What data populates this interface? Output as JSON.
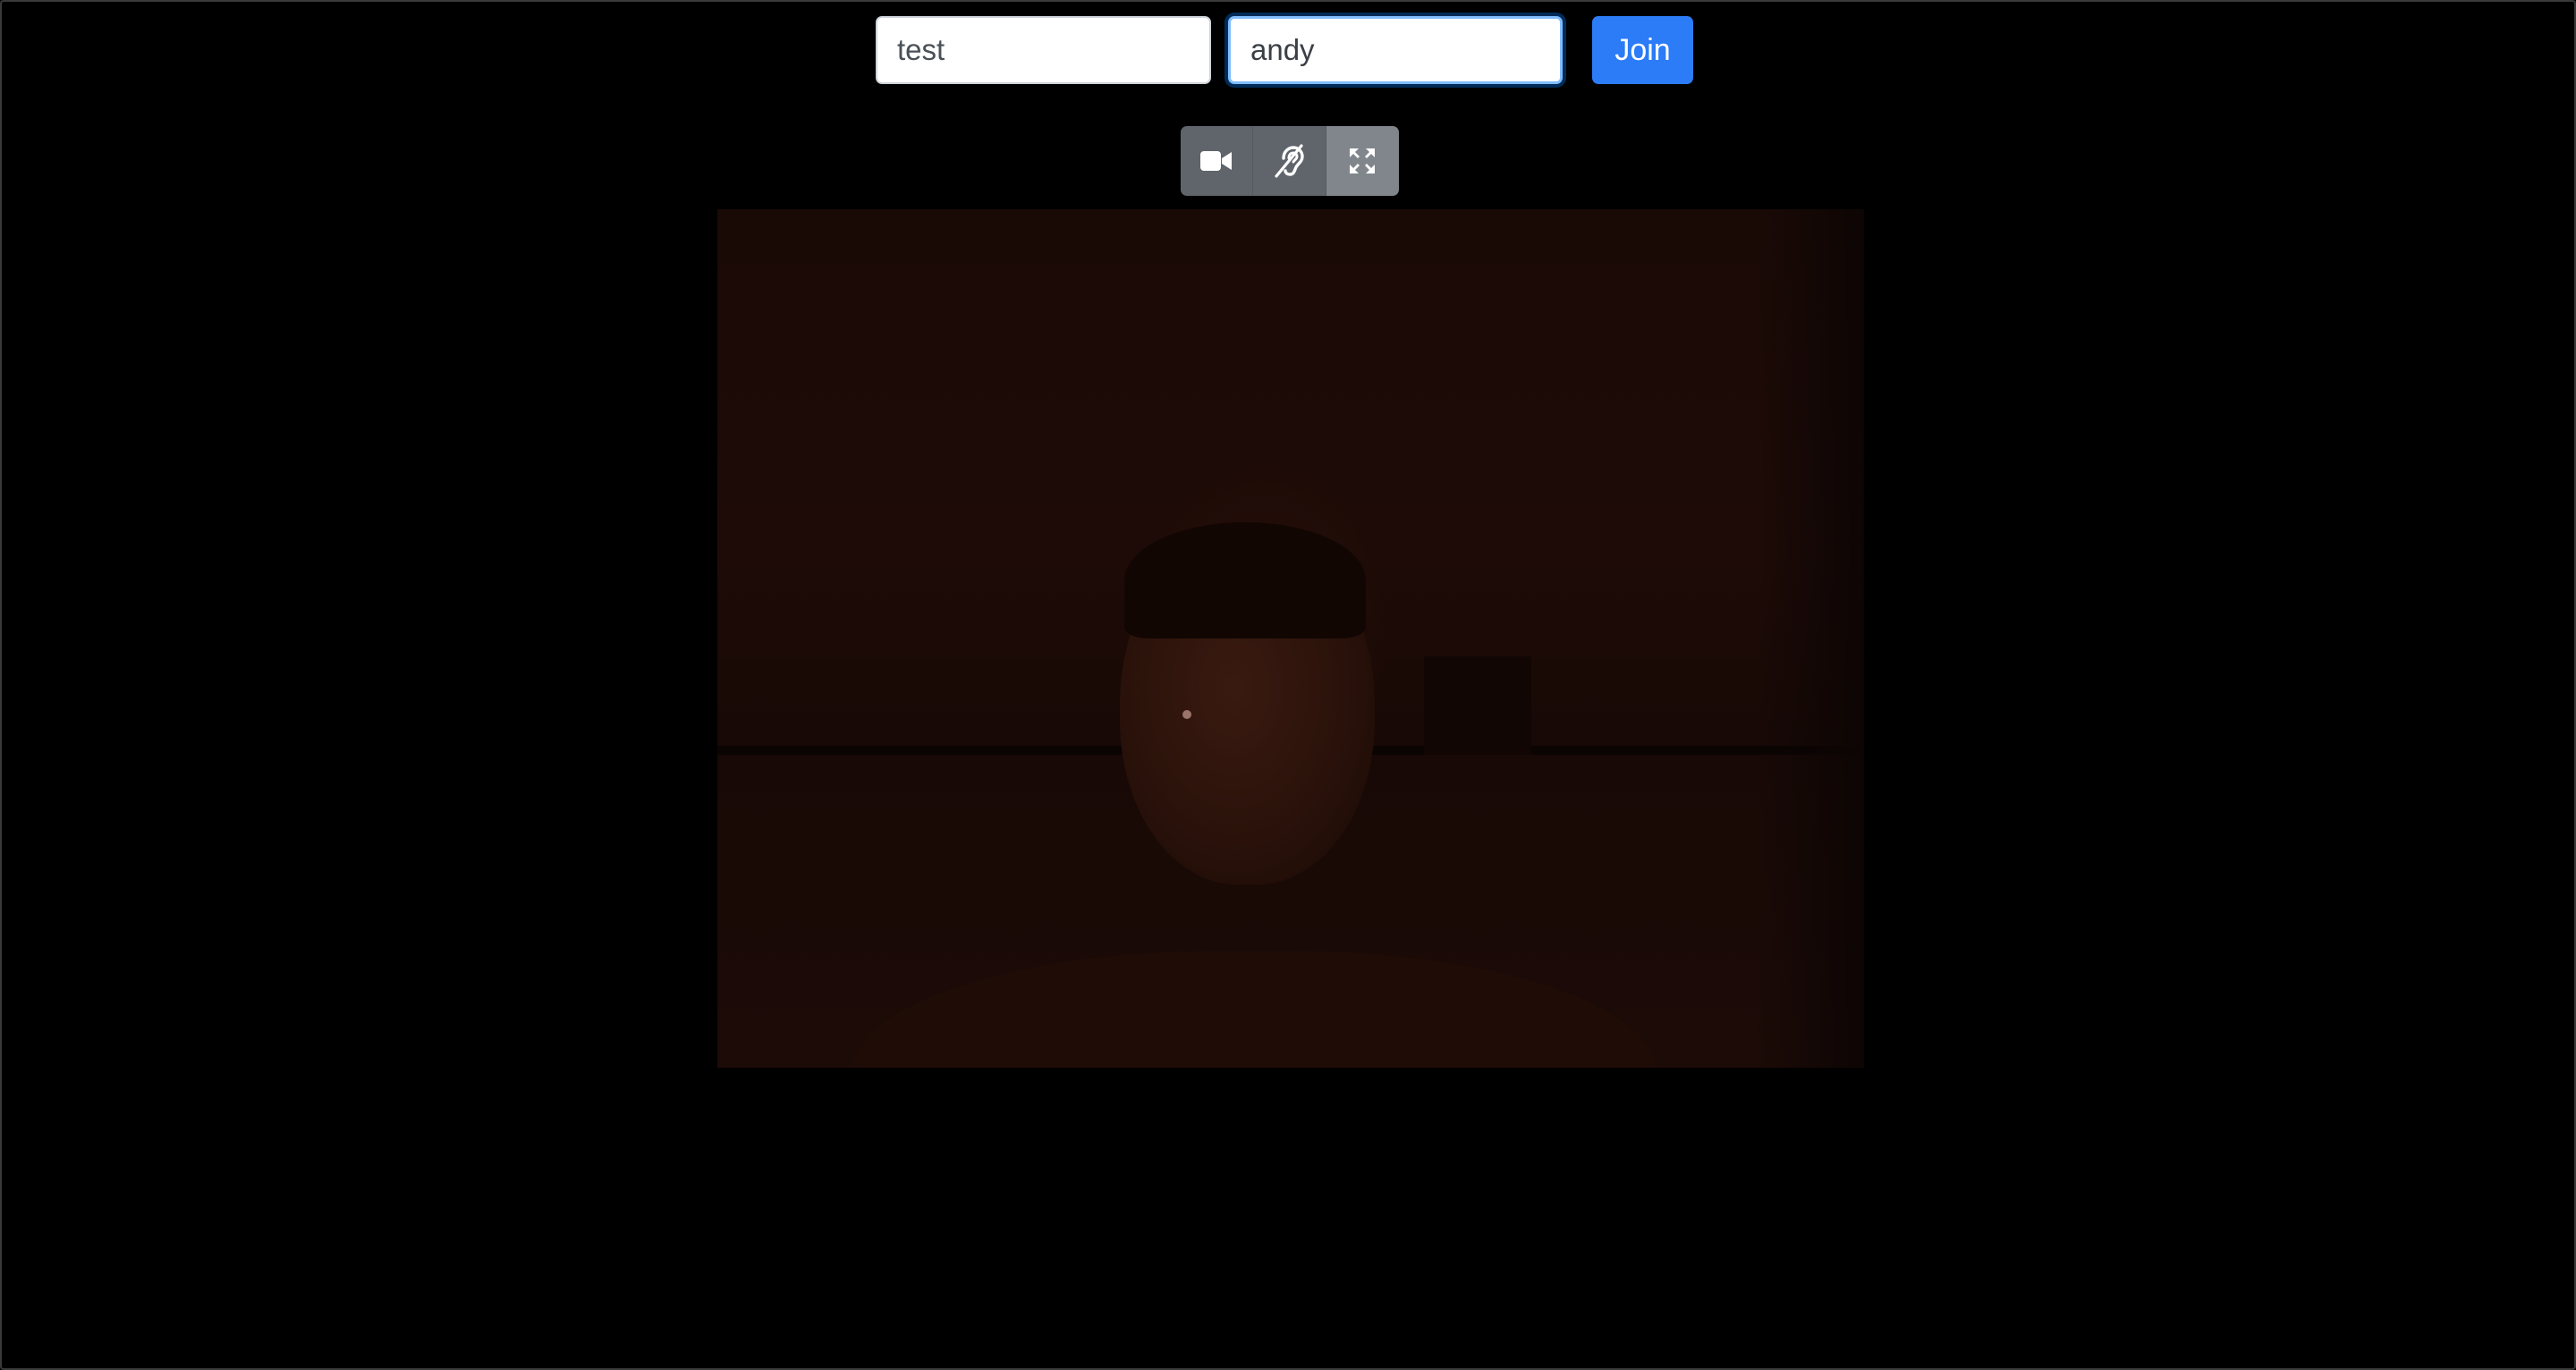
{
  "join_form": {
    "room_value": "test",
    "username_value": "andy",
    "join_label": "Join"
  },
  "toolbar": {
    "buttons": [
      {
        "icon": "video-camera-icon"
      },
      {
        "icon": "hearing-assist-icon"
      },
      {
        "icon": "expand-fullscreen-icon"
      }
    ]
  },
  "colors": {
    "background": "#000000",
    "primary": "#2b7cf6",
    "toolbar": "#5f656b",
    "toolbar_active": "#80868c",
    "focus_ring": "#80bdff"
  }
}
